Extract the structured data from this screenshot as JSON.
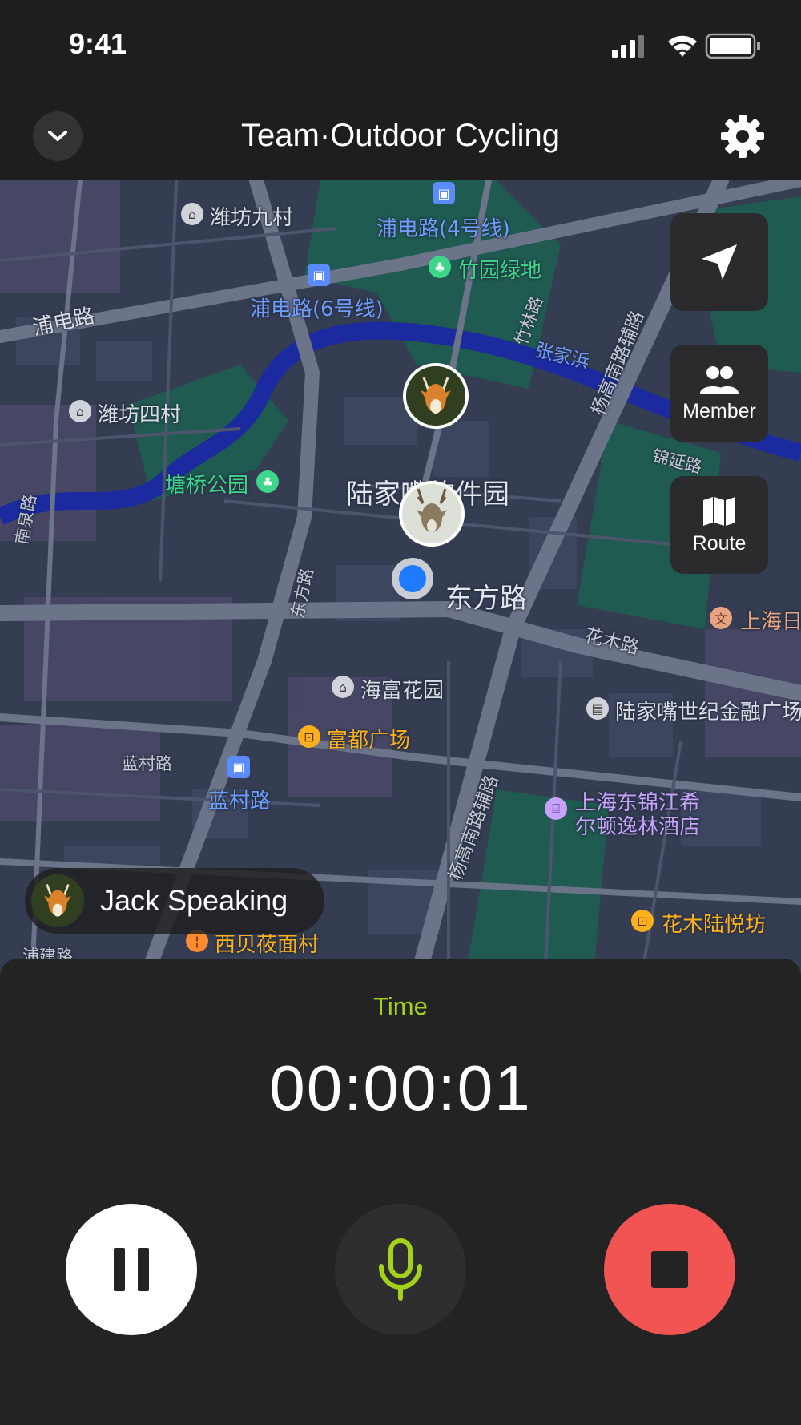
{
  "status_bar": {
    "time": "9:41"
  },
  "header": {
    "title": "Team·Outdoor Cycling"
  },
  "map": {
    "labels": {
      "weifang9": "潍坊九村",
      "pudian4": "浦电路(4号线)",
      "zhuyuan": "竹园绿地",
      "pudian6": "浦电路(6号线)",
      "pudianlu": "浦电路",
      "zhangjiabang": "张家浜",
      "weifang4": "潍坊四村",
      "tangqiao": "塘桥公园",
      "lujiazui_soft": "陆家嘴软件园",
      "dongfanglu": "东方路",
      "dongfanglu_road": "东方路",
      "nanquanlu": "南泉路",
      "zhulinlu": "竹林路",
      "yanggao_n": "杨高南路辅路",
      "jinyanlu": "锦延路",
      "shanghai_ri": "上海日",
      "huamulu": "花木路",
      "haifu": "海富花园",
      "lujiazui_century": "陆家嘴世纪金融广场",
      "fudu": "富都广场",
      "lancunlu_road": "蓝村路",
      "lancunlu": "蓝村路",
      "yanggao_s": "杨高南路辅路",
      "hilton_1": "上海东锦江希",
      "hilton_2": "尔顿逸林酒店",
      "huamu_lueyue": "花木陆悦坊",
      "xibei": "西贝莜面村",
      "pujianlu": "浦建路"
    }
  },
  "side_buttons": {
    "member": "Member",
    "route": "Route"
  },
  "speaking": {
    "text": "Jack Speaking"
  },
  "panel": {
    "time_label": "Time",
    "time_value": "00:00:01"
  },
  "colors": {
    "accent": "#a4d11c",
    "stop": "#f25454",
    "location": "#1e7bff"
  }
}
